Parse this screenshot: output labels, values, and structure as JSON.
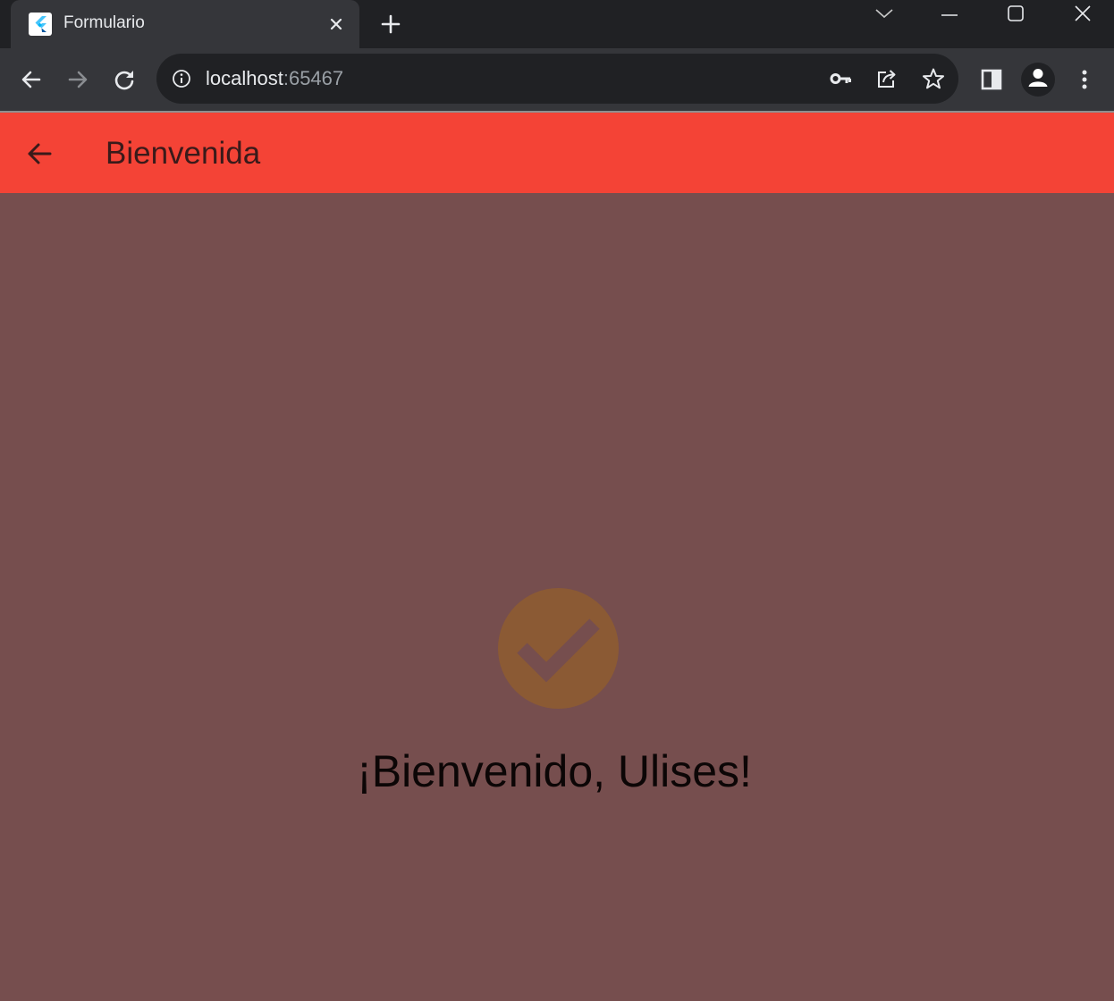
{
  "browser": {
    "tab": {
      "title": "Formulario",
      "favicon": "flutter-logo-icon",
      "close_icon": "close-icon"
    },
    "new_tab_icon": "plus-icon",
    "window_controls": [
      "chevron-down-icon",
      "minimize-icon",
      "maximize-icon",
      "close-icon"
    ],
    "toolbar": {
      "back_icon": "arrow-left-icon",
      "forward_icon": "arrow-right-icon",
      "reload_icon": "reload-icon",
      "site_info_icon": "info-icon",
      "url_host": "localhost",
      "url_port": ":65467",
      "key_icon": "key-icon",
      "share_icon": "share-icon",
      "bookmark_icon": "star-icon",
      "side_panel_icon": "side-panel-icon",
      "profile_icon": "person-icon",
      "menu_icon": "kebab-menu-icon"
    }
  },
  "app": {
    "appbar": {
      "back_icon": "arrow-left-icon",
      "title": "Bienvenida",
      "color": "#f44336"
    },
    "body": {
      "background": "#764e4e",
      "icon": "check-circle-icon",
      "icon_color": "#8b5a34",
      "message": "¡Bienvenido, Ulises!"
    }
  }
}
